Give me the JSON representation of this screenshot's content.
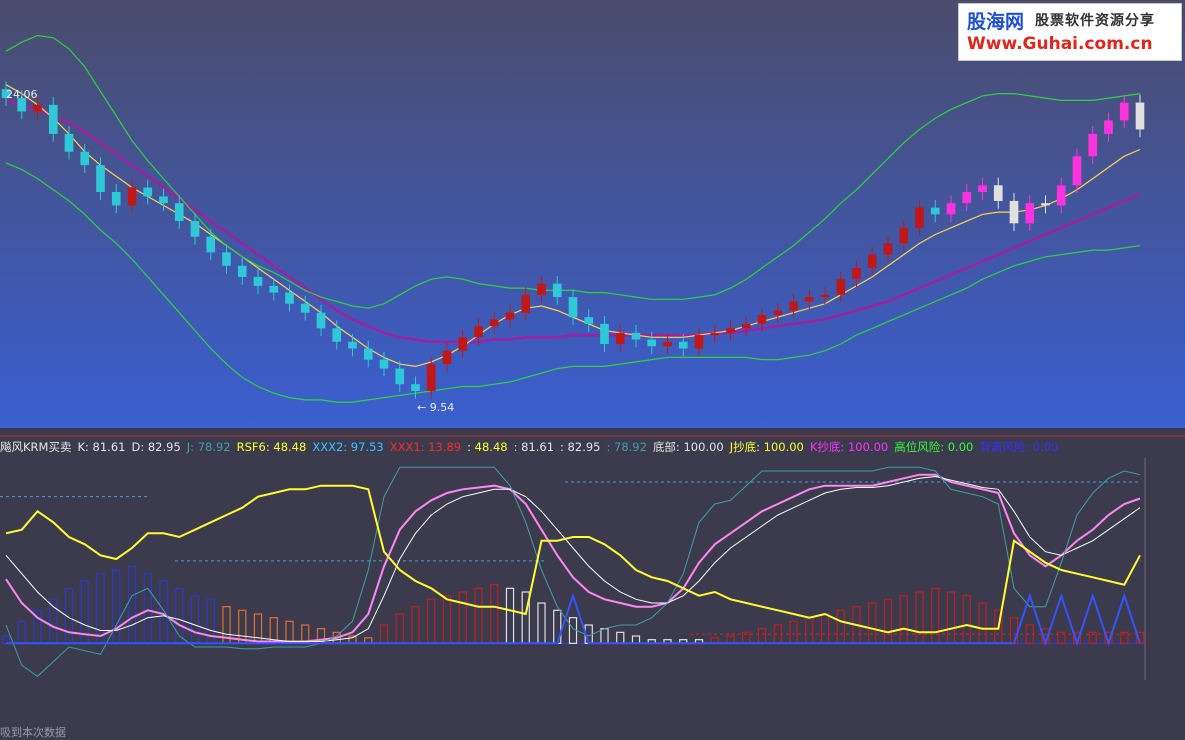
{
  "watermark": {
    "brand": "股海网",
    "slogan": "股票软件资源分享",
    "url": "Www.Guhai.com.cn"
  },
  "price_panel": {
    "high_label": "24.06",
    "low_label": "9.54"
  },
  "indicator_bar": {
    "items": [
      {
        "text": "飚风KRM买卖",
        "color": "#e6e6e6"
      },
      {
        "text": "K: 81.61",
        "color": "#e6e6e6"
      },
      {
        "text": "D: 82.95",
        "color": "#e6e6e6"
      },
      {
        "text": "J: 78.92",
        "color": "#3fa0a8"
      },
      {
        "text": "RSF6: 48.48",
        "color": "#ffff33"
      },
      {
        "text": "XXX2: 97.53",
        "color": "#33c8ff"
      },
      {
        "text": "XXX1: 13.89",
        "color": "#ff2a2a"
      },
      {
        "text": ": 48.48",
        "color": "#ffff33"
      },
      {
        "text": ": 81.61",
        "color": "#e6e6e6"
      },
      {
        "text": ": 82.95",
        "color": "#e6e6e6"
      },
      {
        "text": ": 78.92",
        "color": "#3fa0a8"
      },
      {
        "text": "底部: 100.00",
        "color": "#e6e6e6"
      },
      {
        "text": "J抄底: 100.00",
        "color": "#ffff33"
      },
      {
        "text": "K抄底: 100.00",
        "color": "#ff33ff"
      },
      {
        "text": "高位风险: 0.00",
        "color": "#33ff33"
      },
      {
        "text": "背离风险: 0.00",
        "color": "#3333ff"
      }
    ]
  },
  "footer_note": "吸到本次数据",
  "chart_data": {
    "type": "line",
    "title": "",
    "panels": [
      {
        "name": "",
        "kind": "candlestick",
        "ylim": [
          9,
          26
        ],
        "high": 24.06,
        "low": 9.54,
        "bar_count": 73,
        "close": [
          23.4,
          22.8,
          23.1,
          21.8,
          21.0,
          20.4,
          19.2,
          18.6,
          19.4,
          19.0,
          18.7,
          17.9,
          17.2,
          16.5,
          15.9,
          15.4,
          15.0,
          14.7,
          14.2,
          13.8,
          13.1,
          12.5,
          12.2,
          11.7,
          11.3,
          10.6,
          10.3,
          11.5,
          12.1,
          12.7,
          13.2,
          13.5,
          13.8,
          14.6,
          15.1,
          14.5,
          13.6,
          13.3,
          12.4,
          12.9,
          12.6,
          12.3,
          12.5,
          12.2,
          12.8,
          12.9,
          13.1,
          13.3,
          13.7,
          13.9,
          14.3,
          14.5,
          14.6,
          15.3,
          15.8,
          16.4,
          16.9,
          17.6,
          18.5,
          18.2,
          18.7,
          19.2,
          19.5,
          18.8,
          17.8,
          18.7,
          18.6,
          19.5,
          20.8,
          21.8,
          22.4,
          23.2,
          22.0
        ],
        "series": [
          {
            "name": "",
            "color": "#a020a0",
            "values": [
              23.3,
              23.1,
              22.9,
              22.6,
              22.3,
              21.9,
              21.4,
              20.9,
              20.4,
              19.9,
              19.4,
              18.9,
              18.4,
              17.9,
              17.4,
              16.9,
              16.4,
              15.9,
              15.4,
              14.9,
              14.4,
              13.9,
              13.5,
              13.2,
              12.9,
              12.7,
              12.6,
              12.5,
              12.5,
              12.5,
              12.5,
              12.6,
              12.6,
              12.7,
              12.7,
              12.7,
              12.8,
              12.8,
              12.8,
              12.8,
              12.8,
              12.8,
              12.8,
              12.8,
              12.8,
              12.9,
              12.9,
              13.0,
              13.1,
              13.2,
              13.3,
              13.4,
              13.5,
              13.7,
              13.9,
              14.1,
              14.3,
              14.6,
              14.9,
              15.2,
              15.5,
              15.8,
              16.1,
              16.4,
              16.7,
              17.0,
              17.3,
              17.6,
              17.9,
              18.2,
              18.5,
              18.8,
              19.1
            ]
          },
          {
            "name": "",
            "color": "#ffd24d",
            "values": [
              24.0,
              23.6,
              23.1,
              22.5,
              21.8,
              21.0,
              20.4,
              19.9,
              19.4,
              19.0,
              18.6,
              18.2,
              17.8,
              17.3,
              16.8,
              16.3,
              15.8,
              15.3,
              14.8,
              14.3,
              13.8,
              13.2,
              12.7,
              12.2,
              11.8,
              11.5,
              11.4,
              11.6,
              11.9,
              12.3,
              12.8,
              13.3,
              13.7,
              14.0,
              14.1,
              13.9,
              13.6,
              13.3,
              13.0,
              12.9,
              12.8,
              12.7,
              12.7,
              12.7,
              12.8,
              12.9,
              13.0,
              13.2,
              13.4,
              13.6,
              13.8,
              14.0,
              14.2,
              14.6,
              15.0,
              15.4,
              15.9,
              16.4,
              16.9,
              17.3,
              17.6,
              17.9,
              18.2,
              18.3,
              18.3,
              18.4,
              18.6,
              18.9,
              19.3,
              19.8,
              20.3,
              20.8,
              21.1
            ]
          },
          {
            "name": "",
            "color": "#30d040",
            "values": [
              25.5,
              25.9,
              26.2,
              26.1,
              25.6,
              24.8,
              23.7,
              22.6,
              21.5,
              20.6,
              19.8,
              19.0,
              18.2,
              17.4,
              16.8,
              16.3,
              15.9,
              15.6,
              15.2,
              14.8,
              14.5,
              14.3,
              14.1,
              14.0,
              14.2,
              14.6,
              15.0,
              15.3,
              15.4,
              15.3,
              15.1,
              15.0,
              14.9,
              14.9,
              14.8,
              14.8,
              14.8,
              14.7,
              14.7,
              14.6,
              14.5,
              14.4,
              14.4,
              14.4,
              14.5,
              14.6,
              14.9,
              15.3,
              15.8,
              16.3,
              16.8,
              17.4,
              18.0,
              18.7,
              19.3,
              20.0,
              20.7,
              21.4,
              22.0,
              22.5,
              22.9,
              23.2,
              23.5,
              23.6,
              23.6,
              23.5,
              23.4,
              23.3,
              23.3,
              23.3,
              23.4,
              23.5,
              23.6
            ]
          },
          {
            "name": "",
            "color": "#30d040",
            "values": [
              20.5,
              20.2,
              19.8,
              19.3,
              18.8,
              18.2,
              17.5,
              16.9,
              16.2,
              15.4,
              14.6,
              13.8,
              13.0,
              12.2,
              11.5,
              10.9,
              10.5,
              10.2,
              10.0,
              9.9,
              9.9,
              9.8,
              9.8,
              9.9,
              10.0,
              10.1,
              10.2,
              10.3,
              10.4,
              10.5,
              10.5,
              10.6,
              10.7,
              10.9,
              11.1,
              11.3,
              11.4,
              11.4,
              11.4,
              11.5,
              11.6,
              11.7,
              11.8,
              11.8,
              11.8,
              11.8,
              11.8,
              11.8,
              11.7,
              11.7,
              11.8,
              11.9,
              12.1,
              12.4,
              12.8,
              13.1,
              13.4,
              13.7,
              14.0,
              14.3,
              14.6,
              14.9,
              15.3,
              15.6,
              15.9,
              16.1,
              16.3,
              16.4,
              16.5,
              16.6,
              16.6,
              16.7,
              16.8
            ]
          }
        ]
      },
      {
        "name": "飚风KRM买卖",
        "kind": "indicator",
        "ylim": [
          -20,
          100
        ],
        "count": 73,
        "series": [
          {
            "name": "K",
            "color": "#ff88ee",
            "values": [
              35,
              22,
              14,
              9,
              6,
              5,
              4,
              8,
              14,
              18,
              16,
              10,
              6,
              4,
              3,
              2,
              1,
              1,
              1,
              1,
              2,
              3,
              6,
              16,
              42,
              62,
              72,
              78,
              82,
              84,
              85,
              86,
              84,
              76,
              62,
              48,
              36,
              28,
              24,
              22,
              20,
              20,
              22,
              30,
              44,
              54,
              60,
              66,
              72,
              76,
              80,
              84,
              86,
              86,
              86,
              86,
              88,
              90,
              92,
              92,
              88,
              86,
              84,
              82,
              60,
              48,
              42,
              48,
              56,
              62,
              70,
              76,
              79
            ]
          },
          {
            "name": "D",
            "color": "#ffffff",
            "values": [
              48,
              38,
              28,
              20,
              14,
              10,
              7,
              7,
              10,
              14,
              15,
              13,
              10,
              7,
              5,
              4,
              3,
              2,
              1,
              1,
              1,
              2,
              3,
              8,
              26,
              46,
              60,
              70,
              76,
              80,
              82,
              84,
              84,
              80,
              72,
              62,
              52,
              42,
              34,
              28,
              24,
              22,
              22,
              26,
              34,
              44,
              52,
              58,
              64,
              70,
              74,
              78,
              82,
              84,
              85,
              85,
              86,
              88,
              90,
              91,
              89,
              87,
              85,
              84,
              72,
              58,
              50,
              48,
              52,
              56,
              62,
              68,
              74
            ]
          },
          {
            "name": "J",
            "color": "#3fa0a8",
            "values": [
              10,
              -12,
              -18,
              -10,
              -2,
              -4,
              -6,
              10,
              26,
              30,
              18,
              4,
              -2,
              -2,
              -2,
              -3,
              -3,
              -2,
              -2,
              -2,
              0,
              4,
              12,
              40,
              80,
              96,
              96,
              96,
              96,
              96,
              96,
              96,
              86,
              66,
              40,
              20,
              8,
              4,
              8,
              10,
              10,
              14,
              22,
              38,
              66,
              76,
              78,
              86,
              94,
              94,
              94,
              94,
              94,
              94,
              94,
              94,
              96,
              96,
              96,
              94,
              84,
              82,
              80,
              76,
              30,
              20,
              20,
              44,
              70,
              82,
              90,
              94,
              92
            ]
          },
          {
            "name": "RSF6",
            "color": "#ffff33",
            "values": [
              60,
              62,
              72,
              66,
              58,
              54,
              48,
              46,
              52,
              60,
              60,
              58,
              62,
              66,
              70,
              74,
              80,
              82,
              84,
              84,
              86,
              86,
              86,
              84,
              50,
              40,
              34,
              30,
              24,
              22,
              20,
              20,
              18,
              16,
              56,
              56,
              58,
              58,
              54,
              48,
              40,
              36,
              34,
              30,
              26,
              28,
              24,
              22,
              20,
              18,
              16,
              14,
              16,
              12,
              10,
              8,
              6,
              8,
              6,
              6,
              8,
              10,
              8,
              8,
              56,
              50,
              44,
              40,
              38,
              36,
              34,
              32,
              48
            ]
          },
          {
            "name": "XXX1",
            "color": "#e0452a",
            "kind": "bar",
            "values": [
              4,
              12,
              18,
              24,
              30,
              34,
              38,
              40,
              42,
              38,
              34,
              30,
              26,
              24,
              20,
              18,
              16,
              14,
              12,
              10,
              8,
              6,
              4,
              3,
              10,
              16,
              20,
              24,
              26,
              28,
              30,
              32,
              30,
              28,
              22,
              18,
              14,
              10,
              8,
              6,
              4,
              2,
              2,
              2,
              2,
              3,
              4,
              6,
              8,
              10,
              12,
              14,
              16,
              18,
              20,
              22,
              24,
              26,
              28,
              30,
              28,
              26,
              22,
              18,
              14,
              10,
              8,
              6,
              6,
              6,
              6,
              6,
              6
            ]
          },
          {
            "name": "XXX2",
            "color": "#3355ff",
            "kind": "line",
            "values": [
              0,
              0,
              0,
              0,
              0,
              0,
              0,
              0,
              0,
              0,
              0,
              0,
              0,
              0,
              0,
              0,
              0,
              0,
              0,
              0,
              0,
              0,
              0,
              0,
              0,
              0,
              0,
              0,
              0,
              0,
              0,
              0,
              0,
              0,
              0,
              0,
              26,
              0,
              0,
              0,
              0,
              0,
              0,
              0,
              0,
              0,
              0,
              0,
              0,
              0,
              0,
              0,
              0,
              0,
              0,
              0,
              0,
              0,
              0,
              0,
              0,
              0,
              0,
              0,
              0,
              26,
              0,
              26,
              0,
              26,
              0,
              26,
              0
            ]
          }
        ]
      }
    ]
  }
}
